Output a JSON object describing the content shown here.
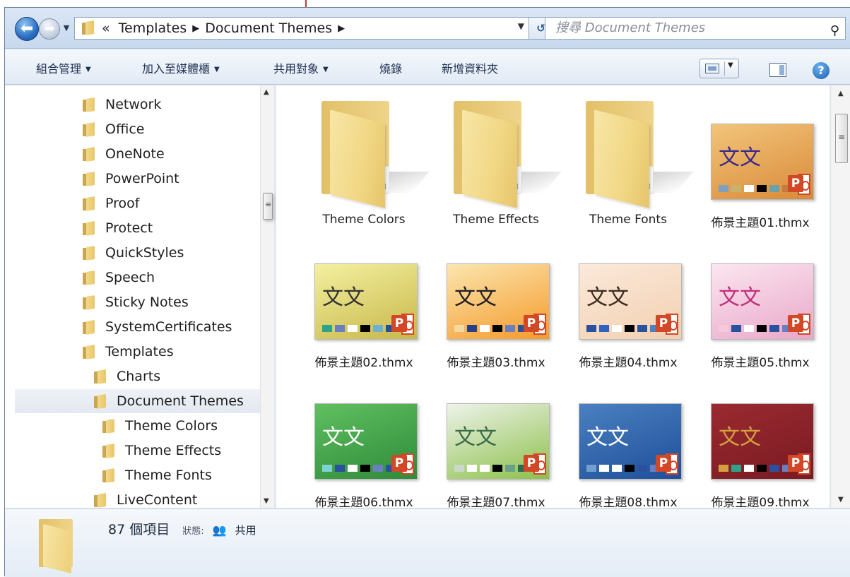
{
  "address": {
    "crumbs": [
      "Templates",
      "Document Themes"
    ],
    "overflow_glyph": "«"
  },
  "search": {
    "placeholder": "搜尋 Document Themes"
  },
  "toolbar": {
    "organize": "組合管理",
    "add_to_library": "加入至媒體櫃",
    "share_with": "共用對象",
    "burn": "燒錄",
    "new_folder": "新增資料夾"
  },
  "nav_tree": [
    {
      "label": "Network",
      "level": 0
    },
    {
      "label": "Office",
      "level": 0
    },
    {
      "label": "OneNote",
      "level": 0
    },
    {
      "label": "PowerPoint",
      "level": 0
    },
    {
      "label": "Proof",
      "level": 0
    },
    {
      "label": "Protect",
      "level": 0
    },
    {
      "label": "QuickStyles",
      "level": 0
    },
    {
      "label": "Speech",
      "level": 0
    },
    {
      "label": "Sticky Notes",
      "level": 0
    },
    {
      "label": "SystemCertificates",
      "level": 0
    },
    {
      "label": "Templates",
      "level": 0
    },
    {
      "label": "Charts",
      "level": 1
    },
    {
      "label": "Document Themes",
      "level": 1,
      "selected": true
    },
    {
      "label": "Theme Colors",
      "level": 2
    },
    {
      "label": "Theme Effects",
      "level": 2
    },
    {
      "label": "Theme Fonts",
      "level": 2
    },
    {
      "label": "LiveContent",
      "level": 1
    }
  ],
  "items": [
    {
      "name": "Theme Colors",
      "kind": "folder"
    },
    {
      "name": "Theme Effects",
      "kind": "folder"
    },
    {
      "name": "Theme Fonts",
      "kind": "folder"
    },
    {
      "name": "佈景主題01.thmx",
      "kind": "theme",
      "bg": "#d98a3a",
      "bg2": "#f2c57a",
      "text_color": "#3b2a8a",
      "swatches": [
        "#7f9fbf",
        "#c9b36a",
        "#ffffff",
        "#000000",
        "#6aa0a8",
        "#c97a3a"
      ]
    },
    {
      "name": "佈景主題02.thmx",
      "kind": "theme",
      "bg": "#c8b84a",
      "bg2": "#f4f0a0",
      "text_color": "#333333",
      "swatches": [
        "#2aa38a",
        "#6a7fc0",
        "#ffffff",
        "#000000",
        "#6fb0d0",
        "#2050a0"
      ]
    },
    {
      "name": "佈景主題03.thmx",
      "kind": "theme",
      "bg": "#f59a2a",
      "bg2": "#fbe6b0",
      "text_color": "#1e1e1e",
      "swatches": [
        "#f4d9a0",
        "#2a3f8a",
        "#ffffff",
        "#000000",
        "#6a7fc0",
        "#2a50a0"
      ]
    },
    {
      "name": "佈景主題04.thmx",
      "kind": "theme",
      "bg": "#f2d0b0",
      "bg2": "#fbe9da",
      "text_color": "#3a2a20",
      "swatches": [
        "#2a50a0",
        "#3060c0",
        "#ffffff",
        "#000000",
        "#2a50a0",
        "#5080c0"
      ]
    },
    {
      "name": "佈景主題05.thmx",
      "kind": "theme",
      "bg": "#e9a7c9",
      "bg2": "#fbe6f0",
      "text_color": "#c0307a",
      "swatches": [
        "#f4c9d9",
        "#2a50a0",
        "#ffffff",
        "#000000",
        "#2a50a0",
        "#6a7fc0"
      ]
    },
    {
      "name": "佈景主題06.thmx",
      "kind": "theme",
      "bg": "#2f8a3a",
      "bg2": "#5fc060",
      "text_color": "#ffffff",
      "swatches": [
        "#7fd0d0",
        "#2a50a0",
        "#ffffff",
        "#000000",
        "#6a7fc0",
        "#2a50a0"
      ]
    },
    {
      "name": "佈景主題07.thmx",
      "kind": "theme",
      "bg": "#8cc04a",
      "bg2": "#eef3ea",
      "text_color": "#3a6a4a",
      "swatches": [
        "#c9d9c9",
        "#ffffff",
        "#ffffff",
        "#000000",
        "#6aa08a",
        "#2a6a50"
      ]
    },
    {
      "name": "佈景主題08.thmx",
      "kind": "theme",
      "bg": "#1f4f9a",
      "bg2": "#4a80c0",
      "text_color": "#ffffff",
      "swatches": [
        "#6fa0d0",
        "#ffffff",
        "#ffffff",
        "#000000",
        "#2a50a0",
        "#6a7fc0"
      ]
    },
    {
      "name": "佈景主題09.thmx",
      "kind": "theme",
      "bg": "#7a1a22",
      "bg2": "#9a2a30",
      "text_color": "#d4a040",
      "swatches": [
        "#d4a040",
        "#2aa38a",
        "#ffffff",
        "#000000",
        "#2a50a0",
        "#6a7fc0"
      ]
    }
  ],
  "thumb_text": "文文",
  "details": {
    "count": "87 個項目",
    "status_label": "狀態:",
    "status_value": "共用"
  }
}
